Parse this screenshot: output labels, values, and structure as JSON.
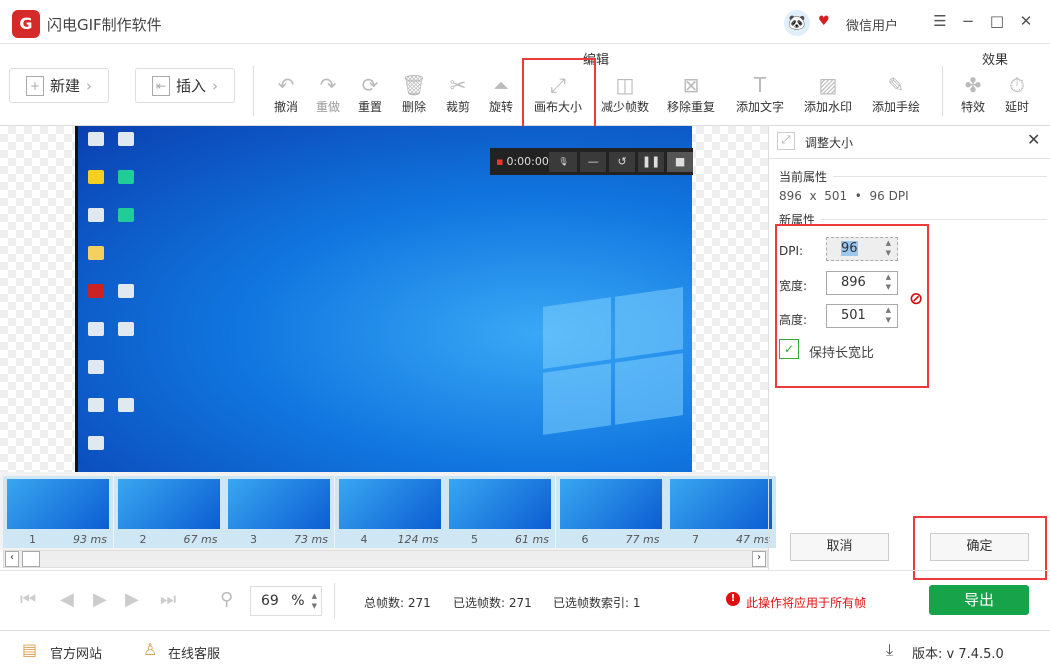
{
  "app": {
    "title": "闪电GIF制作软件",
    "logo": "G",
    "user": "微信用户"
  },
  "toolbar": {
    "new_label": "新建",
    "insert_label": "插入",
    "edit_group": "编辑",
    "effects_group": "效果",
    "tools": [
      {
        "label": "撤消",
        "icon": "↶"
      },
      {
        "label": "重做",
        "icon": "↷"
      },
      {
        "label": "重置",
        "icon": "⟳"
      },
      {
        "label": "删除",
        "icon": "🗑"
      },
      {
        "label": "裁剪",
        "icon": "✂"
      },
      {
        "label": "旋转",
        "icon": "⏶"
      },
      {
        "label": "画布大小",
        "icon": "⤢"
      },
      {
        "label": "减少帧数",
        "icon": "◫"
      },
      {
        "label": "移除重复",
        "icon": "⊠"
      },
      {
        "label": "添加文字",
        "icon": "T"
      },
      {
        "label": "添加水印",
        "icon": "▨"
      },
      {
        "label": "添加手绘",
        "icon": "✎"
      }
    ],
    "effects": [
      {
        "label": "特效",
        "icon": "✤"
      },
      {
        "label": "延时",
        "icon": "⏱"
      }
    ]
  },
  "recorder": {
    "time": "0:00:00"
  },
  "frames": [
    {
      "index": "1",
      "delay": "93 ms"
    },
    {
      "index": "2",
      "delay": "67 ms"
    },
    {
      "index": "3",
      "delay": "73 ms"
    },
    {
      "index": "4",
      "delay": "124 ms"
    },
    {
      "index": "5",
      "delay": "61 ms"
    },
    {
      "index": "6",
      "delay": "77 ms"
    },
    {
      "index": "7",
      "delay": "47 ms"
    }
  ],
  "panel": {
    "title": "调整大小",
    "current_label": "当前属性",
    "current_value": "896  x  501  •  96 DPI",
    "new_label": "新属性",
    "dpi_label": "DPI:",
    "dpi": "96",
    "width_label": "宽度:",
    "width": "896",
    "height_label": "高度:",
    "height": "501",
    "keep_ratio": "保持长宽比",
    "cancel": "取消",
    "ok": "确定"
  },
  "status": {
    "zoom": "69",
    "zoom_unit": "%",
    "total_frames": "总帧数: 271",
    "selected_frames": "已选帧数: 271",
    "selected_index": "已选帧数索引: 1",
    "warning": "此操作将应用于所有帧",
    "export": "导出"
  },
  "footer": {
    "website": "官方网站",
    "support": "在线客服",
    "version": "版本: v 7.4.5.0"
  }
}
